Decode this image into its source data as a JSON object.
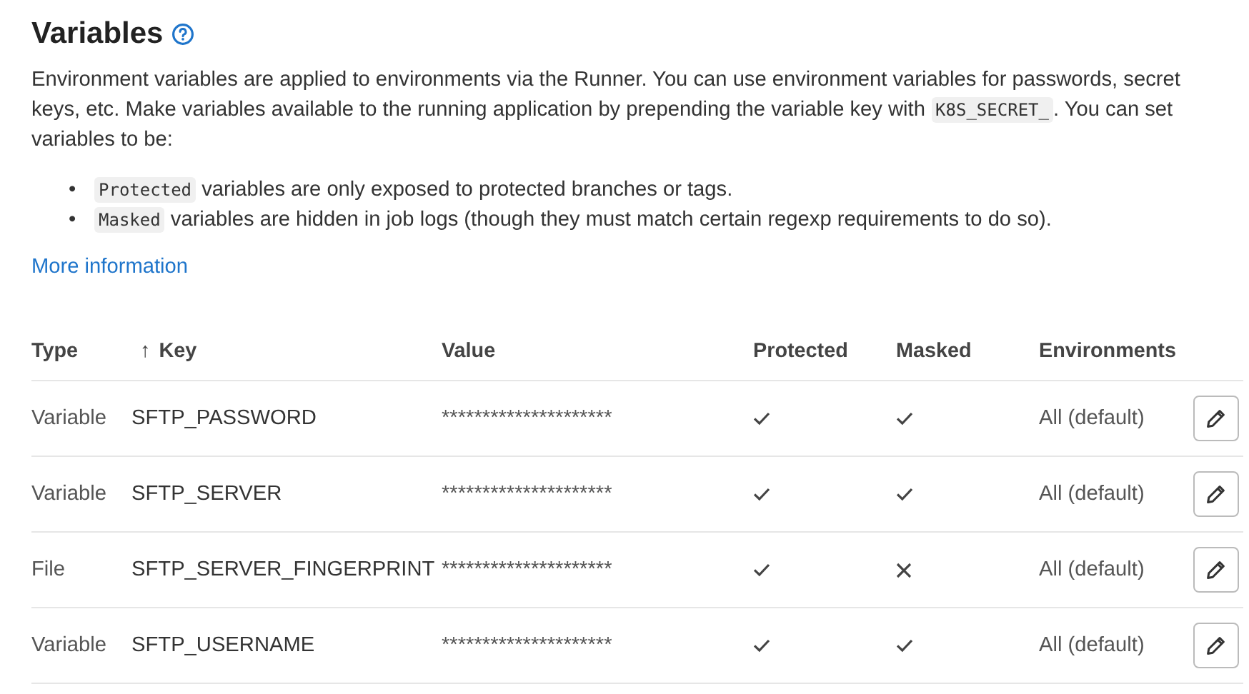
{
  "title": "Variables",
  "intro": [
    {
      "kind": "text",
      "text": "Environment variables are applied to environments via the Runner. You can use environment variables for passwords, secret keys, etc. Make variables available to the running application by prepending the variable key with "
    },
    {
      "kind": "code",
      "text": "K8S_SECRET_"
    },
    {
      "kind": "text",
      "text": ". You can set variables to be:"
    }
  ],
  "bullets": [
    {
      "marker": "•",
      "code": "Protected",
      "text": "variables are only exposed to protected branches or tags."
    },
    {
      "marker": "•",
      "code": "Masked",
      "text": "variables are hidden in job logs (though they must match certain regexp requirements to do so)."
    }
  ],
  "more_link": "More information",
  "table": {
    "columns": [
      {
        "label": "Type"
      },
      {
        "label": "Key",
        "sort_indicator": "↑"
      },
      {
        "label": "Value"
      },
      {
        "label": "Protected"
      },
      {
        "label": "Masked"
      },
      {
        "label": "Environments"
      }
    ],
    "rows": [
      {
        "type": "Variable",
        "key": "SFTP_PASSWORD",
        "value": "*********************",
        "protected": true,
        "masked": true,
        "environments": "All (default)"
      },
      {
        "type": "Variable",
        "key": "SFTP_SERVER",
        "value": "*********************",
        "protected": true,
        "masked": true,
        "environments": "All (default)"
      },
      {
        "type": "File",
        "key": "SFTP_SERVER_FINGERPRINT",
        "value": "*********************",
        "protected": true,
        "masked": false,
        "environments": "All (default)"
      },
      {
        "type": "Variable",
        "key": "SFTP_USERNAME",
        "value": "*********************",
        "protected": true,
        "masked": true,
        "environments": "All (default)"
      }
    ]
  }
}
